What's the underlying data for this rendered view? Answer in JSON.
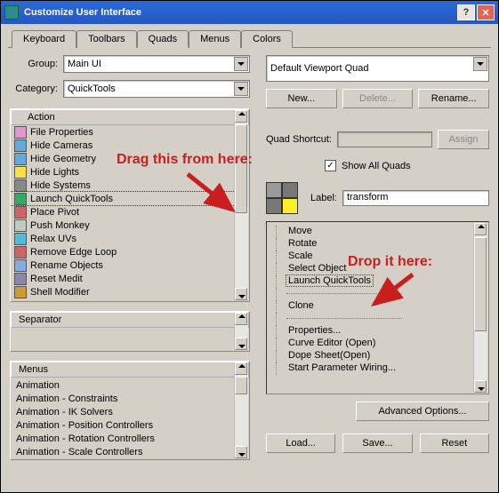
{
  "window": {
    "title": "Customize User Interface"
  },
  "tabs": [
    "Keyboard",
    "Toolbars",
    "Quads",
    "Menus",
    "Colors"
  ],
  "active_tab": 2,
  "left": {
    "group_label": "Group:",
    "group_value": "Main UI",
    "category_label": "Category:",
    "category_value": "QuickTools",
    "action_header": "Action",
    "actions": [
      "File Properties",
      "Hide Cameras",
      "Hide Geometry",
      "Hide Lights",
      "Hide Systems",
      "Launch QuickTools",
      "Place Pivot",
      "Push Monkey",
      "Relax UVs",
      "Remove Edge Loop",
      "Rename Objects",
      "Reset Medit",
      "Shell Modifier"
    ],
    "selected_action_index": 5,
    "separator_label": "Separator",
    "menus_label": "Menus",
    "menus": [
      "Animation",
      "Animation - Constraints",
      "Animation - IK Solvers",
      "Animation - Position Controllers",
      "Animation - Rotation Controllers",
      "Animation - Scale Controllers"
    ]
  },
  "right": {
    "quad_dropdown": "Default Viewport Quad",
    "btn_new": "New...",
    "btn_delete": "Delete...",
    "btn_rename": "Rename...",
    "quad_shortcut_label": "Quad Shortcut:",
    "btn_assign": "Assign",
    "show_all_label": "Show All Quads",
    "show_all_checked": true,
    "label_label": "Label:",
    "label_value": "transform",
    "quad_colors": [
      "#9a9a9a",
      "#787878",
      "#787878",
      "#ffef2a"
    ],
    "tree": [
      "Move",
      "Rotate",
      "Scale",
      "Select Object",
      "Launch QuickTools",
      "",
      "Clone",
      "",
      "Properties...",
      "Curve Editor (Open)",
      "Dope Sheet(Open)",
      "Start Parameter Wiring..."
    ],
    "tree_selected_index": 4,
    "btn_advanced": "Advanced Options...",
    "btn_load": "Load...",
    "btn_save": "Save...",
    "btn_reset": "Reset"
  },
  "annotations": {
    "drag": "Drag this from here:",
    "drop": "Drop it here:"
  }
}
